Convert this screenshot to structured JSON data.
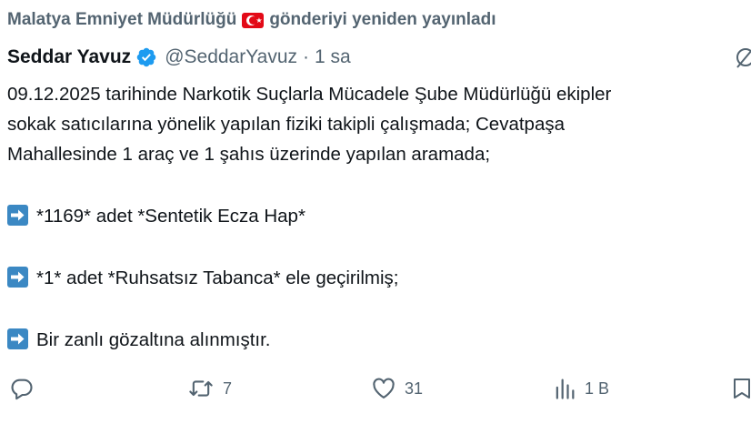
{
  "repost_banner": {
    "account": "Malatya Emniyet Müdürlüğü",
    "flag_icon": "turkey-flag-icon",
    "action_text": "gönderiyi yeniden yayınladı"
  },
  "author": {
    "display_name": "Seddar Yavuz",
    "verified_icon": "verified-badge-icon",
    "handle": "@SeddarYavuz",
    "separator": "·",
    "time": "1 sa"
  },
  "tweet": {
    "lines": [
      "09.12.2025 tarihinde Narkotik Suçlarla Mücadele Şube Müdürlüğü ekipler",
      "sokak satıcılarına yönelik yapılan fiziki takipli çalışmada; Cevatpaşa",
      "Mahallesinde 1 araç ve 1 şahıs üzerinde yapılan aramada;"
    ],
    "bullets": [
      "*1169* adet *Sentetik Ecza Hap*",
      "*1* adet *Ruhsatsız Tabanca* ele geçirilmiş;",
      "Bir zanlı gözaltına alınmıştır."
    ]
  },
  "actions": {
    "reply_count": "",
    "repost_count": "7",
    "like_count": "31",
    "views_count": "1 B"
  },
  "colors": {
    "text": "#0f1419",
    "muted": "#536471",
    "verified": "#1d9bf0",
    "arrow_emoji_bg": "#3b88c3"
  }
}
